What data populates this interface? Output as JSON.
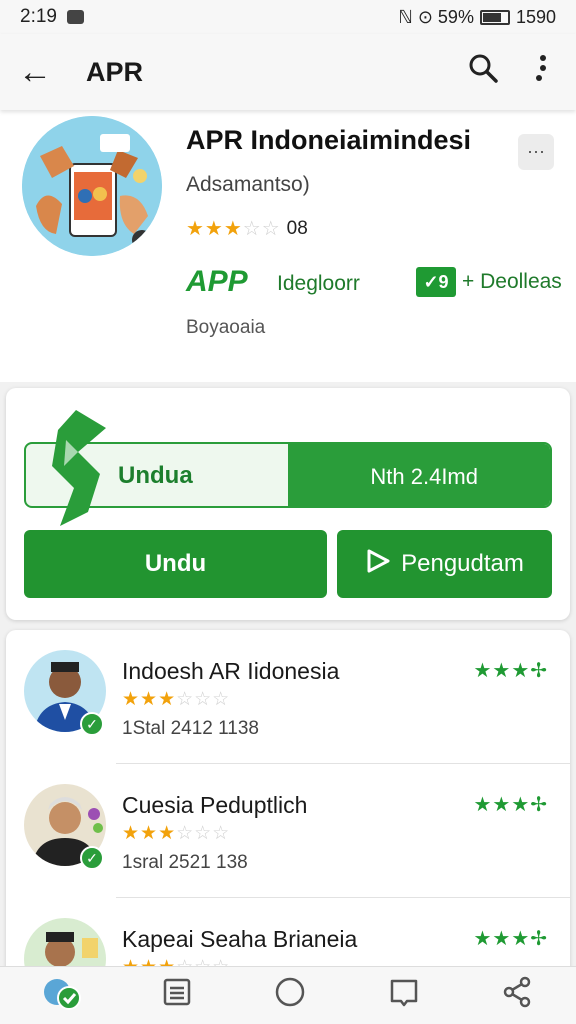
{
  "status": {
    "time": "2:19",
    "battery_text": "ℕ ⊙ 59% ",
    "battery_level": "1590"
  },
  "appbar": {
    "title": "APR",
    "back_icon": "arrow-left-icon",
    "search_icon": "search-icon",
    "menu_icon": "more-vert-icon"
  },
  "app": {
    "name": "APR Indoneiaimindesi",
    "subtitle": "Adsamantso)",
    "rating_count": "08",
    "rating": 3,
    "tag": "APP",
    "developer": "Idegloorr",
    "verified_badge": "✓9",
    "verified_label": "+ Deolleas",
    "category": "Boyaoaia",
    "corner_icon": "expand-icon"
  },
  "actions": {
    "progress_left": "Undua",
    "progress_right": "Nth 2.4Imd",
    "progress_fraction": 0.5,
    "install_label": "Undu",
    "open_label": "Pengudtam",
    "accent": "#229430"
  },
  "list": {
    "items": [
      {
        "name": "Indoesh AR Iidonesia",
        "meta": "1Stal  2412 1138",
        "rating": 3,
        "right_stars": "★★★✢"
      },
      {
        "name": "Cuesia Peduptlich",
        "meta": "1sral  2521 138",
        "rating": 3,
        "right_stars": "★★★✢"
      },
      {
        "name": "Kapeai Seaha Brianeia",
        "meta": "",
        "rating": 3,
        "right_stars": "★★★✢"
      }
    ]
  },
  "nav": {
    "icons": [
      "globe-check-icon",
      "list-icon",
      "home-circle-icon",
      "book-icon",
      "share-icon"
    ]
  }
}
